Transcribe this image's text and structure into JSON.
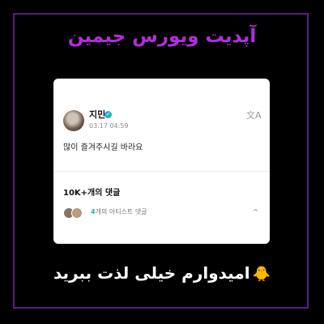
{
  "header": {
    "title": "آپدیت ویورس جیمین"
  },
  "post": {
    "author": "지민",
    "verified_mark": "✓",
    "timestamp": "03.17 04:59",
    "translate_icon": "文A",
    "text": "많이 즐겨주시길 바라요"
  },
  "comments": {
    "title": "10K+개의 댓글",
    "artist_count": "4",
    "artist_label": "개의 아티스트 댓글",
    "chevron": "⌄"
  },
  "footer": {
    "text": "امیدوارم خیلی لذت ببرید",
    "emoji": "🐥"
  },
  "colors": {
    "title": "#b62be0",
    "accent": "#1fb2c9",
    "frame": "#5a1e86"
  }
}
